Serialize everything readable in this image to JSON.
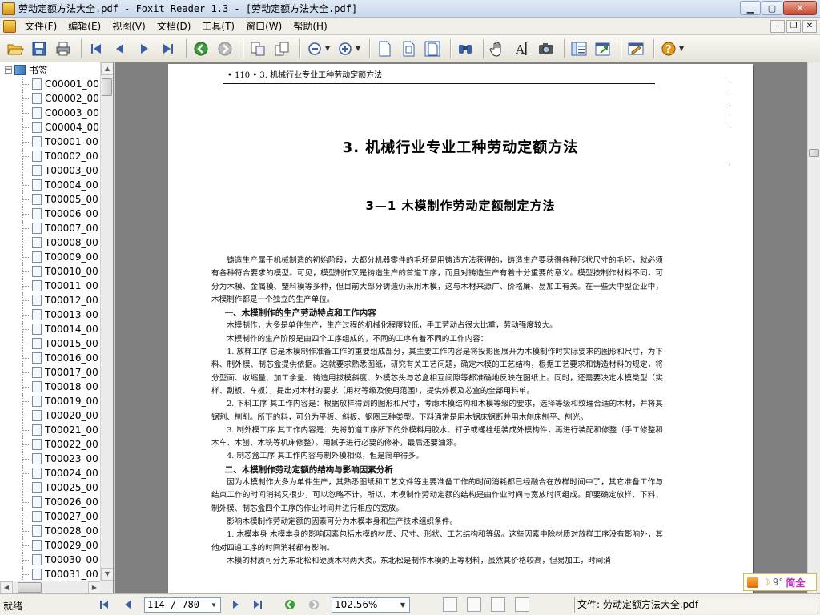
{
  "window": {
    "title": "劳动定额方法大全.pdf - Foxit Reader 1.3 - [劳动定额方法大全.pdf]",
    "controls": [
      "minimize",
      "maximize",
      "close"
    ]
  },
  "menu": {
    "items": [
      "文件(F)",
      "编辑(E)",
      "视图(V)",
      "文档(D)",
      "工具(T)",
      "窗口(W)",
      "帮助(H)"
    ]
  },
  "toolbar": {
    "buttons": [
      "open-icon",
      "save-icon",
      "print-icon",
      "first-page-icon",
      "prev-page-icon",
      "next-page-icon",
      "last-page-icon",
      "back-icon",
      "forward-icon",
      "rotate-icon",
      "copy-icon",
      "zoom-out-icon",
      "zoom-in-icon",
      "actual-size-icon",
      "fit-page-icon",
      "fit-width-icon",
      "find-icon",
      "hand-icon",
      "text-select-icon",
      "snapshot-icon",
      "bookmarks-panel-icon",
      "export-icon",
      "annotate-icon",
      "help-icon"
    ]
  },
  "sidebar": {
    "root_label": "书签",
    "items": [
      "C00001_00",
      "C00002_00",
      "C00003_00",
      "C00004_00",
      "T00001_00",
      "T00002_00",
      "T00003_00",
      "T00004_00",
      "T00005_00",
      "T00006_00",
      "T00007_00",
      "T00008_00",
      "T00009_00",
      "T00010_00",
      "T00011_00",
      "T00012_00",
      "T00013_00",
      "T00014_00",
      "T00015_00",
      "T00016_00",
      "T00017_00",
      "T00018_00",
      "T00019_00",
      "T00020_00",
      "T00021_00",
      "T00022_00",
      "T00023_00",
      "T00024_00",
      "T00025_00",
      "T00026_00",
      "T00027_00",
      "T00028_00",
      "T00029_00",
      "T00030_00",
      "T00031_00"
    ]
  },
  "document": {
    "header": "• 110 •    3. 机械行业专业工种劳动定额方法",
    "title": "3. 机械行业专业工种劳动定额方法",
    "subtitle": "3—1   木模制作劳动定额制定方法",
    "paragraphs": [
      {
        "kind": "p",
        "text": "铸造生产属于机械制造的初始阶段，大都分机器零件的毛坯是用铸造方法获得的，铸造生产要获得各种形状尺寸的毛坯，就必须有各种符合要求的模型。可见，模型制作又是铸造生产的首道工序，而且对铸造生产有着十分重要的意义。模型按制作材料不同，可分为木模、金属模、塑料模等多种，但目前大部分铸造仍采用木模，这与木材来源广、价格廉、易加工有关。在一些大中型企业中，木模制作都是一个独立的生产单位。"
      },
      {
        "kind": "h",
        "text": "一、木模制作的生产劳动特点和工作内容"
      },
      {
        "kind": "p",
        "text": "木模制作，大多是单件生产，生产过程的机械化程度较低，手工劳动占很大比重，劳动强度较大。"
      },
      {
        "kind": "p",
        "text": "木模制作的生产阶段是由四个工序组成的，不同的工序有着不同的工作内容："
      },
      {
        "kind": "p",
        "text": "1. 放样工序   它是木模制作准备工作的重要组成部分，其主要工作内容是将投影图展开为木模制作时实际要求的图形和尺寸，为下料、制外模、制芯盒提供依据。这就要求熟悉图纸，研究有关工艺问题，确定木模的工艺结构，根据工艺要求和铸造材料的规定，将分型面、收缩量、加工余量、铸造用拔模斜度、外模芯头与芯盒相互间隙等都准确地反映在图纸上。同时，还需要决定木模类型（实样、刮板、车板），提出对木材的要求（用材等级及使用范围），提供外模及芯盒的全部用料单。"
      },
      {
        "kind": "p",
        "text": "2. 下料工序   其工作内容是：根据放样得到的图形和尺寸，考虑木模结构和木模等级的要求，选择等级和纹理合适的木材，并将其锯割、刨削。所下的料，可分为平板、斜板、钢圈三种类型。下料通常是用木锯床锯断并用木刨床刨平、刨光。"
      },
      {
        "kind": "p",
        "text": "3. 制外模工序   其工作内容是：先将前道工序所下的外模料用胶水、钉子或螺栓组装成外模构件，再进行装配和修整（手工修整和木车、木刨、木铣等机床修整）。用腻子进行必要的修补，最后还要油漆。"
      },
      {
        "kind": "p",
        "text": "4. 制芯盒工序   其工作内容与制外模相似，但是简单得多。"
      },
      {
        "kind": "h",
        "text": "二、木模制作劳动定额的结构与影响因素分析"
      },
      {
        "kind": "p",
        "text": "因为木模制作大多为单件生产，其熟悉图纸和工艺文件等主要准备工作的时间消耗都已经融合在放样时间中了，其它准备工作与结束工作的时间消耗又很少，可以忽略不计。所以，木模制作劳动定额的结构是由作业时间与宽放时间组成。即要确定放样、下料、制外模、制芯盒四个工序的作业时间并进行相应的宽放。"
      },
      {
        "kind": "p",
        "text": "影响木模制作劳动定额的因素可分为木模本身和生产技术组织条件。"
      },
      {
        "kind": "p",
        "text": "1. 木模本身   木模本身的影响因素包括木模的材质、尺寸、形状、工艺结构和等级。这些因素中除材质对放样工序没有影响外，其他对四道工序的时间消耗都有影响。"
      },
      {
        "kind": "p",
        "text": "木模的材质可分为东北松和硬质木材两大类。东北松是制作木模的上等材料，虽然其价格较高，但易加工，时间消"
      }
    ]
  },
  "ime": {
    "label": "简全",
    "mode": "9°"
  },
  "status": {
    "text": "就绪",
    "page": "114 / 780",
    "zoom": "102.56%",
    "file_label": "文件: 劳动定额方法大全.pdf"
  }
}
